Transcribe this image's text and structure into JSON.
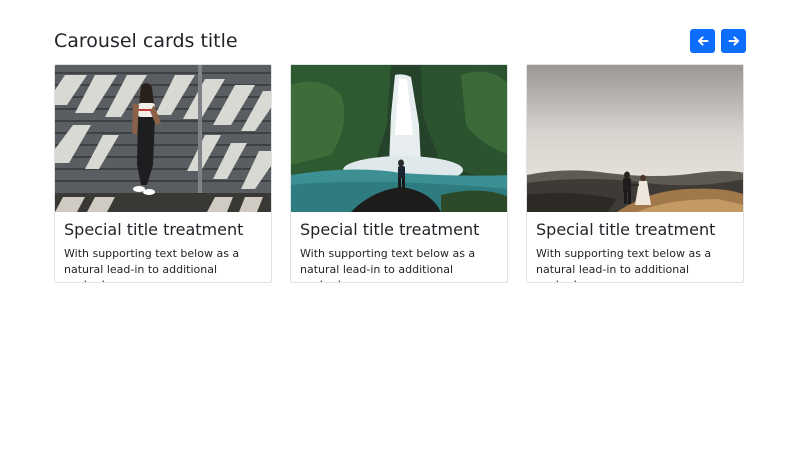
{
  "section": {
    "title": "Carousel cards title",
    "accent_color": "#0d6efd"
  },
  "nav": {
    "prev_icon": "arrow-left-icon",
    "next_icon": "arrow-right-icon"
  },
  "cards": [
    {
      "image": "woman-leaning-on-striped-wall",
      "title": "Special title treatment",
      "text": "With supporting text below as a natural lead-in to additional content."
    },
    {
      "image": "man-on-rock-at-waterfall",
      "title": "Special title treatment",
      "text": "With supporting text below as a natural lead-in to additional content."
    },
    {
      "image": "couple-walking-on-hill-at-dusk",
      "title": "Special title treatment",
      "text": "With supporting text below as a natural lead-in to additional content."
    }
  ]
}
